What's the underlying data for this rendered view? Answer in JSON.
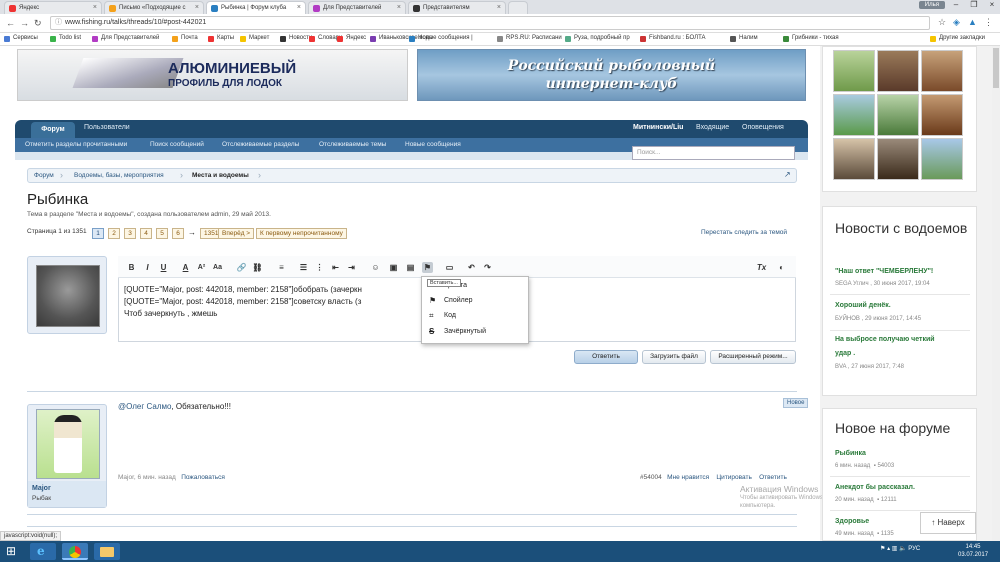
{
  "browser": {
    "tabs": [
      {
        "label": "Яндекс",
        "color": "#e33"
      },
      {
        "label": "Письмо «Подходящие с",
        "color": "#f4a11a"
      },
      {
        "label": "Рыбинка | Форум клуба",
        "color": "#2a7fc1",
        "active": true
      },
      {
        "label": "Для Представителей",
        "color": "#b23cc4"
      },
      {
        "label": "Представителям",
        "color": "#333"
      }
    ],
    "user": "Илья",
    "url": "www.fishing.ru/talks/threads/10/#post-442021"
  },
  "bookmarks": [
    {
      "label": "Сервисы",
      "color": "#4a7bd4"
    },
    {
      "label": "Todo list",
      "color": "#3ab34a"
    },
    {
      "label": "Для Представителей",
      "color": "#b23cc4"
    },
    {
      "label": "Почта",
      "color": "#f4a11a"
    },
    {
      "label": "Карты",
      "color": "#e33"
    },
    {
      "label": "Маркет",
      "color": "#f5c400"
    },
    {
      "label": "Новости",
      "color": "#333"
    },
    {
      "label": "Словари",
      "color": "#e33"
    },
    {
      "label": "Яндекс",
      "color": "#e33"
    },
    {
      "label": "Иваньковское водо",
      "color": "#7a3db0"
    },
    {
      "label": "Новые сообщения |",
      "color": "#2a7fc1"
    },
    {
      "label": "RPS.RU: Расписани",
      "color": "#888"
    },
    {
      "label": "Руза, подробный пр",
      "color": "#5a8"
    },
    {
      "label": "Fishband.ru : БОЛТА",
      "color": "#c33"
    },
    {
      "label": "Налим",
      "color": "#555"
    },
    {
      "label": "Грибники - тихая",
      "color": "#3a8a3a"
    },
    {
      "label": "Другие закладки",
      "color": "#f5c400"
    }
  ],
  "banners": {
    "left_line1": "АЛЮМИНИЕВЫЙ",
    "left_line2": "ПРОФИЛЬ ДЛЯ ЛОДОК",
    "right_line1": "Российский рыболовный",
    "right_line2": "интернет-клуб"
  },
  "nav": {
    "tabs": [
      "Форум",
      "Пользователи"
    ],
    "user": "Митнински/Liu",
    "inbox": "Входящие",
    "alerts": "Оповещения",
    "sub": [
      "Отметить разделы прочитанными",
      "Поиск сообщений",
      "Отслеживаемые разделы",
      "Отслеживаемые темы",
      "Новые сообщения"
    ],
    "search_placeholder": "Поиск..."
  },
  "breadcrumb": [
    "Форум",
    "Водоемы, базы, мероприятия",
    "Места и водоемы"
  ],
  "thread": {
    "title": "Рыбинка",
    "subtitle": "Тема в разделе \"Места и водоемы\", создана пользователем admin, 29 май 2013.",
    "page_info": "Страница 1 из 1351",
    "pages": [
      "1",
      "2",
      "3",
      "4",
      "5",
      "6"
    ],
    "arrow": "→",
    "last_page": "1351",
    "next": "Вперёд >",
    "first_unread": "К первому непрочитанному",
    "unwatch": "Перестать следить за темой"
  },
  "editor": {
    "lines": [
      "[QUOTE=\"Major, post: 442018, member: 2158\"]обобрать (зачеркн",
      "[QUOTE=\"Major, post: 442018, member: 2158\"]советску власть (з",
      "Чтоб зачеркнуть , жмешь"
    ],
    "tooltip": "Вставить...",
    "menu": [
      {
        "label": "Цитата",
        "icon": "quote-icon"
      },
      {
        "label": "Спойлер",
        "icon": "flag-icon"
      },
      {
        "label": "Код",
        "icon": "code-icon"
      },
      {
        "label": "Зачёркнутый",
        "icon": "strikethrough-icon"
      }
    ],
    "reply": "Ответить",
    "upload": "Загрузить файл",
    "advanced": "Расширенный режим..."
  },
  "post": {
    "badge": "Новое",
    "author": "Major",
    "rank": "Рыбак",
    "mention": "@Олег Салмо",
    "text": ", Обязательно!!!",
    "meta_author": "Major",
    "meta_time": "6 мин. назад",
    "report": "Пожаловаться",
    "number": "#54004",
    "like": "Мне нравится",
    "quote": "Цитировать",
    "reply": "Ответить"
  },
  "activation": {
    "title": "Активация Windows",
    "line1": "Чтобы активировать Windows, перейдите в раздел \"Параметры\"",
    "line2": "компьютера."
  },
  "sidebar": {
    "news_title": "Новости с водоемов",
    "news": [
      {
        "title": "\"Наш ответ \"ЧЕМБЕРЛЕНУ\"!",
        "meta": "SEGA Углич , 30 июня 2017, 19:04"
      },
      {
        "title": "Хороший денёк.",
        "meta": "БУЙНОВ , 29 июня 2017, 14:45"
      },
      {
        "title": "На выбросе получаю четкий",
        "title2": "удар .",
        "meta": "BVA , 27 июня 2017, 7:48"
      }
    ],
    "forum_title": "Новое на форуме",
    "forum": [
      {
        "title": "Рыбинка",
        "meta": "6 мин. назад",
        "count": "54003"
      },
      {
        "title": "Анекдот бы рассказал.",
        "meta": "20 мин. назад",
        "count": "12111"
      },
      {
        "title": "Здоровье",
        "meta": "49 мин. назад",
        "count": "1135"
      }
    ],
    "scroll_top": "↑ Наверх"
  },
  "status_url": "javascript:void(null);",
  "taskbar": {
    "lang": "РУС",
    "time": "14:45",
    "date": "03.07.2017"
  }
}
